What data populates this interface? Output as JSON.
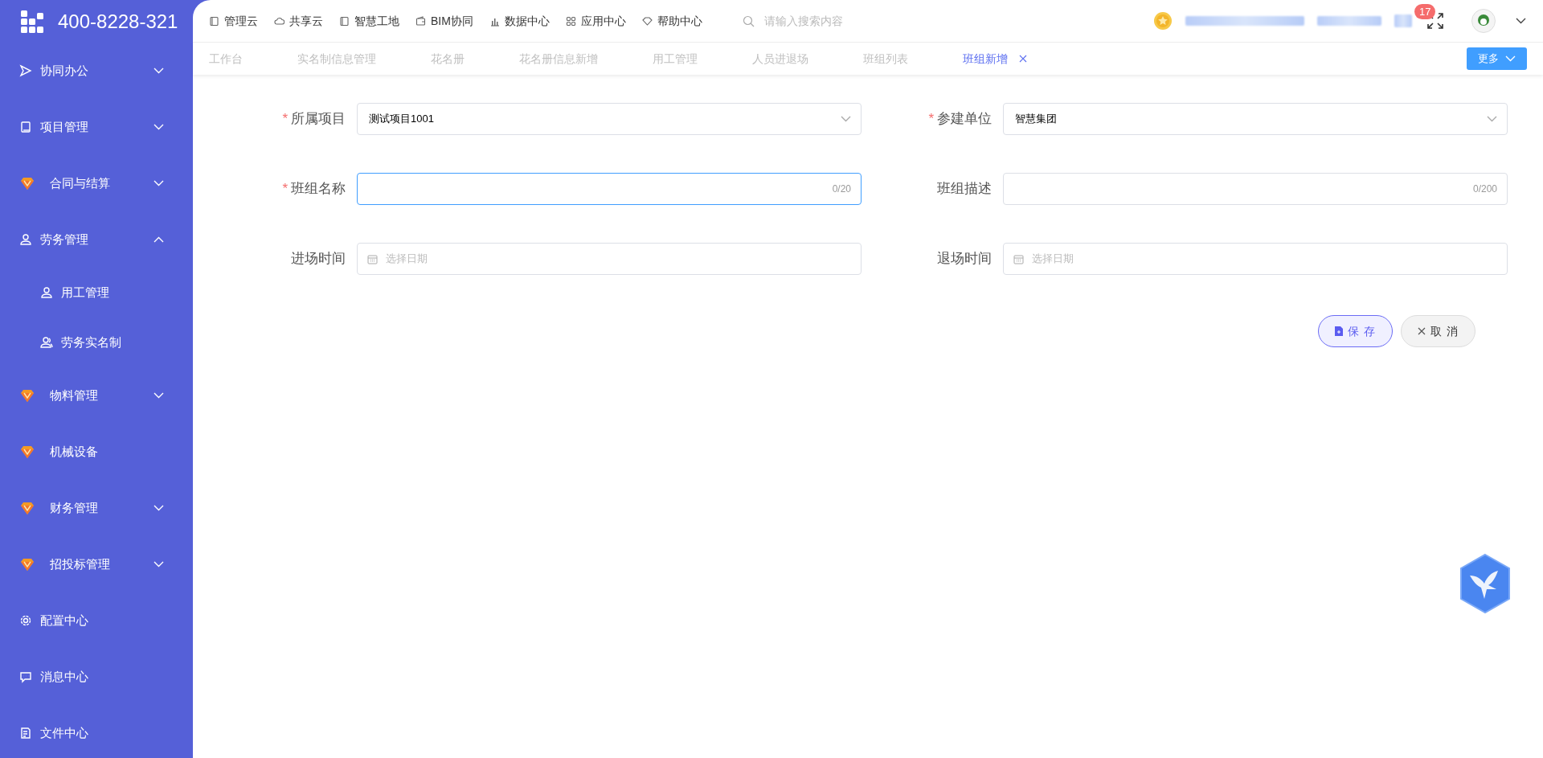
{
  "sidebar": {
    "logo_text": "400-8228-321",
    "items": [
      {
        "label": "协同办公",
        "kind": "send",
        "expanded": false
      },
      {
        "label": "项目管理",
        "kind": "book",
        "expanded": false
      },
      {
        "label": "合同与结算",
        "kind": "gem",
        "expanded": false
      },
      {
        "label": "劳务管理",
        "kind": "person",
        "expanded": true,
        "children": [
          {
            "label": "用工管理",
            "kind": "person"
          },
          {
            "label": "劳务实名制",
            "kind": "people"
          }
        ]
      },
      {
        "label": "物料管理",
        "kind": "gem",
        "expanded": false
      },
      {
        "label": "机械设备",
        "kind": "gem"
      },
      {
        "label": "财务管理",
        "kind": "gem",
        "expanded": false
      },
      {
        "label": "招投标管理",
        "kind": "gem",
        "expanded": false
      },
      {
        "label": "配置中心",
        "kind": "gear"
      },
      {
        "label": "消息中心",
        "kind": "chat"
      },
      {
        "label": "文件中心",
        "kind": "doc"
      }
    ]
  },
  "top_nav": {
    "links": [
      {
        "label": "管理云",
        "kind": "book"
      },
      {
        "label": "共享云",
        "kind": "cloud"
      },
      {
        "label": "智慧工地",
        "kind": "book"
      },
      {
        "label": "BIM协同",
        "kind": "wallet"
      },
      {
        "label": "数据中心",
        "kind": "bars"
      },
      {
        "label": "应用中心",
        "kind": "grid"
      },
      {
        "label": "帮助中心",
        "kind": "diamond"
      }
    ],
    "search": {
      "placeholder": "请输入搜索内容"
    },
    "notification_count": "17"
  },
  "tabs": [
    {
      "label": "工作台",
      "selected": false
    },
    {
      "label": "实名制信息管理",
      "selected": false
    },
    {
      "label": "花名册",
      "selected": false
    },
    {
      "label": "花名册信息新增",
      "selected": false
    },
    {
      "label": "用工管理",
      "selected": false
    },
    {
      "label": "人员进退场",
      "selected": false
    },
    {
      "label": "班组列表",
      "selected": false
    },
    {
      "label": "班组新增",
      "selected": true
    }
  ],
  "more_button": "更多",
  "form": {
    "fields": [
      {
        "label": "所属项目",
        "required_mark": "*",
        "kind": "select",
        "value": "测试项目1001",
        "focused": false
      },
      {
        "label": "参建单位",
        "required_mark": "*",
        "kind": "select",
        "value": "智慧集团",
        "focused": false
      },
      {
        "label": "班组名称",
        "required_mark": "*",
        "kind": "text",
        "counter": "0/20",
        "focused": true
      },
      {
        "label": "班组描述",
        "kind": "text",
        "counter": "0/200",
        "focused": false
      },
      {
        "label": "进场时间",
        "kind": "date",
        "placeholder": "选择日期",
        "focused": false
      },
      {
        "label": "退场时间",
        "kind": "date",
        "placeholder": "选择日期",
        "focused": false
      }
    ],
    "buttons": [
      {
        "label": "保 存",
        "kind": "primary"
      },
      {
        "label": "取 消",
        "kind": "cancel"
      }
    ]
  }
}
